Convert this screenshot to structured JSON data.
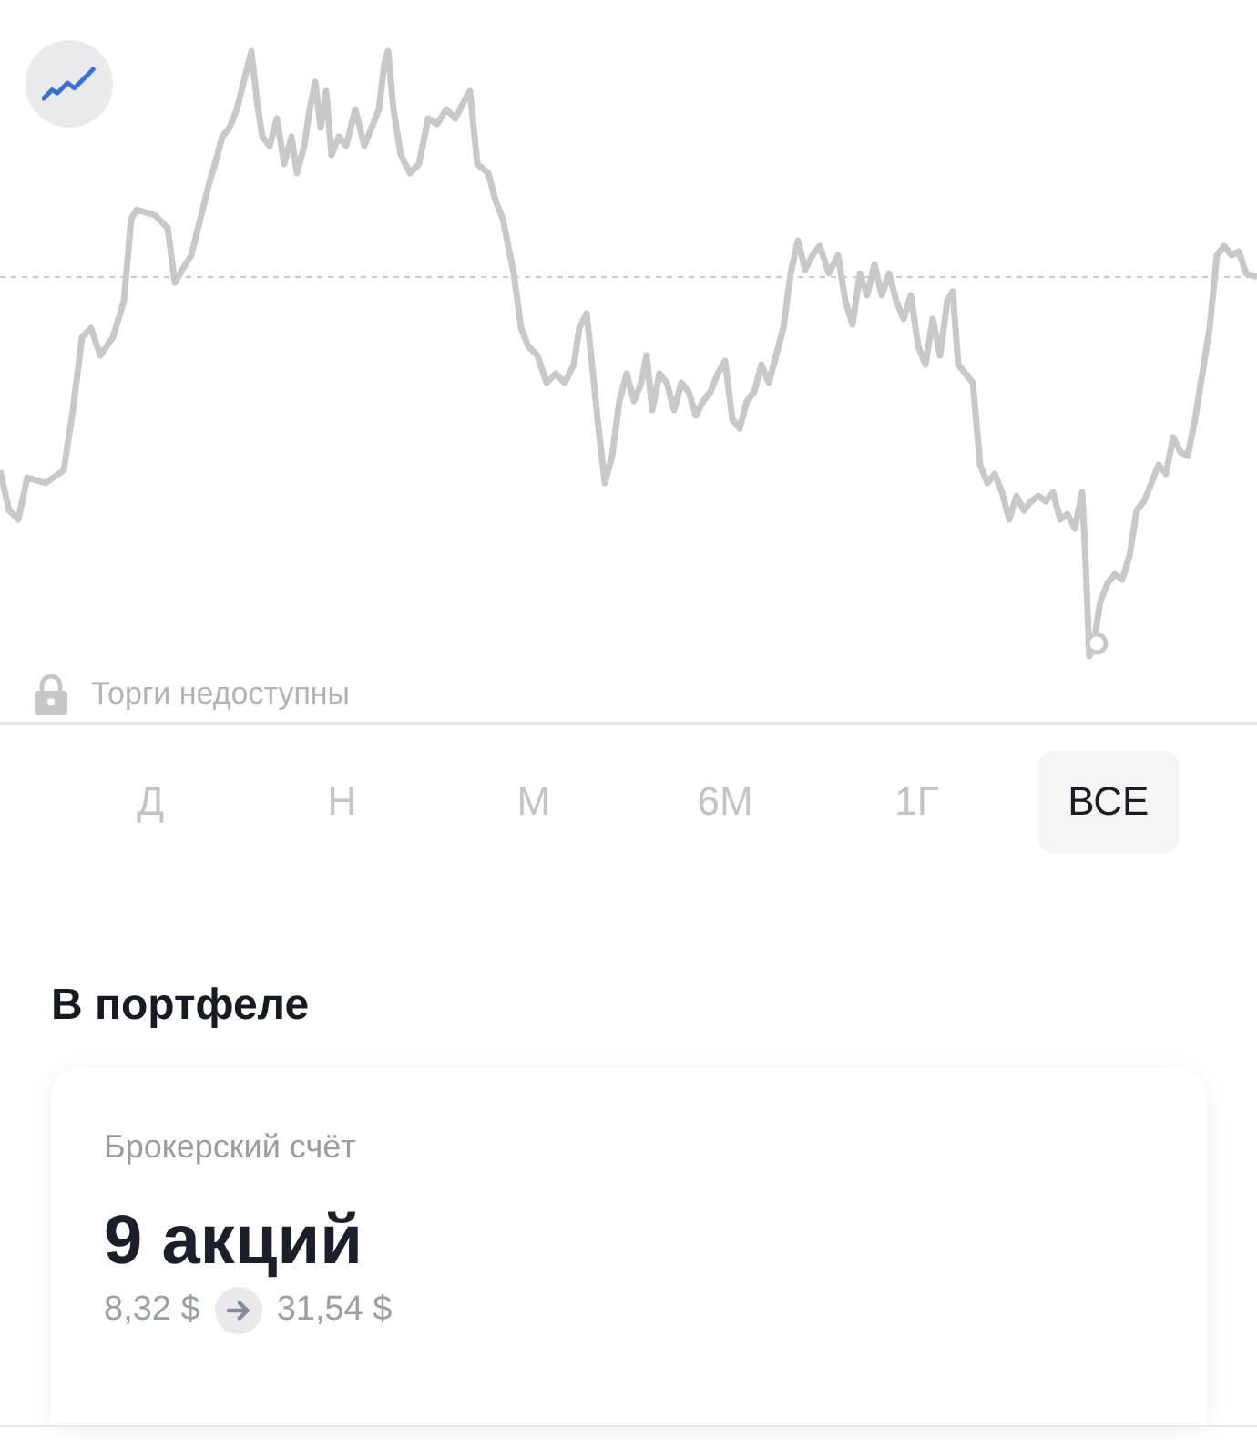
{
  "chart_panel": {
    "trading_status": "Торги недоступны"
  },
  "period_tabs": [
    {
      "label": "Д",
      "selected": false
    },
    {
      "label": "Н",
      "selected": false
    },
    {
      "label": "М",
      "selected": false
    },
    {
      "label": "6М",
      "selected": false
    },
    {
      "label": "1Г",
      "selected": false
    },
    {
      "label": "ВСЕ",
      "selected": true
    }
  ],
  "portfolio": {
    "title": "В портфеле",
    "account": "Брокерский счёт",
    "quantity": "9 акций",
    "price_from": "8,32 $",
    "price_to": "31,54 $"
  }
}
